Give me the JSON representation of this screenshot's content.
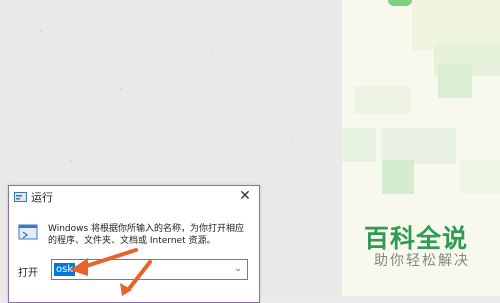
{
  "run_dialog": {
    "title": "运行",
    "close_glyph": "✕",
    "description": "Windows 将根据你所输入的名称，为你打开相应的程序、文件夹、文档或 Internet 资源。",
    "open_label": "打开",
    "command_value": "osk",
    "dropdown_glyph": "⌄"
  },
  "watermark": {
    "title": "百科全说",
    "subtitle": "助你轻松解决"
  },
  "colors": {
    "selection": "#0078d7",
    "annotation_arrow": "#e8622a",
    "watermark_green": "#2f9a55",
    "dialog_border": "#8e6fa8"
  },
  "icons": [
    "run-app-icon",
    "run-program-icon",
    "close-icon",
    "chevron-down-icon",
    "annotation-arrow-icon"
  ]
}
